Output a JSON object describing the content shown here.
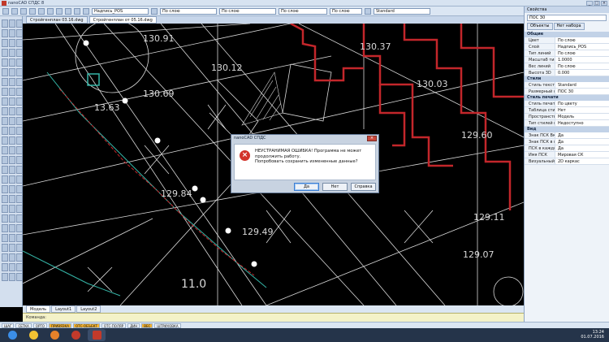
{
  "window": {
    "title": "nanoCAD СПДС 8",
    "controls": [
      "_",
      "□",
      "×"
    ]
  },
  "toolbar": {
    "layer_combo": "Надпись_POS",
    "linetype_combo": "По слою",
    "linetype2_combo": "По слою",
    "lineweight_combo": "По слою",
    "textstyle_combo": "Standard",
    "color_combo": "По слою"
  },
  "doc_tabs": [
    "Стройгенплан 03.16.dwg",
    "Стройгенплан от 05.16.dwg"
  ],
  "drawing": {
    "labels": [
      "130.91",
      "130.37",
      "130.12",
      "130.69",
      "130.03",
      "13.63",
      "129.60",
      "129.84",
      "129.49",
      "129.11",
      "129.07",
      "11.0"
    ],
    "colors": {
      "background": "#000000",
      "building": "#c3262b",
      "lines": "#d9d9d9",
      "cyan": "#35b6a8"
    }
  },
  "layout_tabs": [
    "Модель",
    "Layout1",
    "Layout2"
  ],
  "command_line": "Команда:",
  "status_bar": [
    "ШАГ",
    "СЕТКА",
    "ОРТО",
    "ПРИВЯЗКА",
    "ОТС-ОБЪЕКТ",
    "ОТС-ПОЛЯР",
    "ДИН",
    "ВЕС",
    "ШТРИХОВКА"
  ],
  "props": {
    "panel_title": "Свойства",
    "selector": "ПОС 30",
    "tabs": [
      "Объекты",
      "Нет набора"
    ],
    "sections": [
      {
        "title": "Общие",
        "rows": [
          {
            "k": "Цвет",
            "v": "По слою"
          },
          {
            "k": "Слой",
            "v": "Надпись_POS"
          },
          {
            "k": "Тип линий",
            "v": "По слою"
          },
          {
            "k": "Масштаб типа...",
            "v": "1.0000"
          },
          {
            "k": "Вес линий",
            "v": "По слою"
          },
          {
            "k": "Высота 3D",
            "v": "0.000"
          }
        ]
      },
      {
        "title": "Стили",
        "rows": [
          {
            "k": "Стиль текста",
            "v": "Standard"
          },
          {
            "k": "Размерный ст...",
            "v": "ПОС 30"
          }
        ]
      },
      {
        "title": "Стиль печати",
        "rows": [
          {
            "k": "Стиль печати",
            "v": "По цвету"
          },
          {
            "k": "Таблица стил...",
            "v": "Нет"
          },
          {
            "k": "Пространство...",
            "v": "Модель"
          },
          {
            "k": "Тип стилей пе...",
            "v": "Недоступно"
          }
        ]
      },
      {
        "title": "Вид",
        "rows": [
          {
            "k": "Знак ПСК Вкл",
            "v": "Да"
          },
          {
            "k": "Знак ПСК в на...",
            "v": "Да"
          },
          {
            "k": "ПСК в каждом...",
            "v": "Да"
          },
          {
            "k": "Имя ПСК",
            "v": "Мировая СК"
          },
          {
            "k": "Визуальный с...",
            "v": "2D каркас"
          }
        ]
      }
    ]
  },
  "dialog": {
    "title": "nanoCAD СПДС",
    "message_line1": "НЕУСТРАНИМАЯ ОШИБКА! Программа не может продолжить работу.",
    "message_line2": "Попробовать сохранить измененные данные?",
    "buttons": {
      "yes": "Да",
      "no": "Нет",
      "help": "Справка"
    }
  },
  "taskbar": {
    "time": "13:24",
    "date": "01.07.2016",
    "app_colors": [
      "#3b8ee8",
      "#e6812a",
      "#c23a2b",
      "#c23a2b",
      "#f2c233"
    ]
  }
}
